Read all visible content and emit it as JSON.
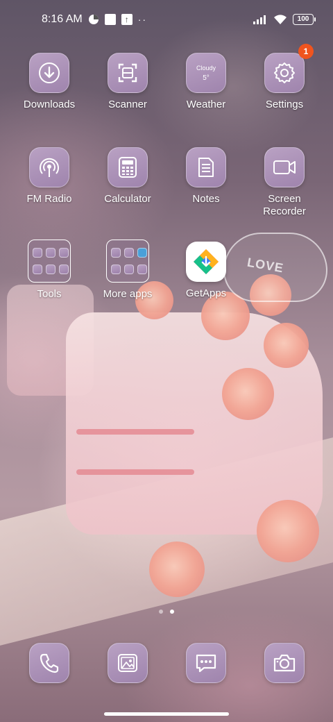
{
  "status_bar": {
    "time": "8:16 AM",
    "battery": "100",
    "icons": [
      "data-saver-icon",
      "notification-square-icon",
      "upload-icon",
      "more-dots-icon",
      "signal-icon",
      "wifi-icon",
      "battery-icon"
    ]
  },
  "apps": {
    "downloads": {
      "label": "Downloads",
      "icon": "download-icon"
    },
    "scanner": {
      "label": "Scanner",
      "icon": "scan-icon"
    },
    "weather": {
      "label": "Weather",
      "condition": "Cloudy",
      "temp": "5°",
      "icon": "weather-widget-icon"
    },
    "settings": {
      "label": "Settings",
      "badge": "1",
      "icon": "gear-icon"
    },
    "fm_radio": {
      "label": "FM Radio",
      "icon": "radio-icon"
    },
    "calculator": {
      "label": "Calculator",
      "icon": "calculator-icon"
    },
    "notes": {
      "label": "Notes",
      "icon": "notes-icon"
    },
    "screen_recorder": {
      "label": "Screen Recorder",
      "icon": "video-camera-icon"
    },
    "tools": {
      "label": "Tools",
      "icon": "folder-icon"
    },
    "more_apps": {
      "label": "More apps",
      "icon": "folder-icon"
    },
    "getapps": {
      "label": "GetApps",
      "icon": "getapps-icon"
    }
  },
  "pager": {
    "pages": 2,
    "active": 2
  },
  "dock": [
    "phone-icon",
    "gallery-icon",
    "messages-icon",
    "camera-icon"
  ],
  "wallpaper": {
    "text": "LOVE"
  },
  "colors": {
    "icon_bg": "#a98db5",
    "badge": "#f0541e"
  }
}
